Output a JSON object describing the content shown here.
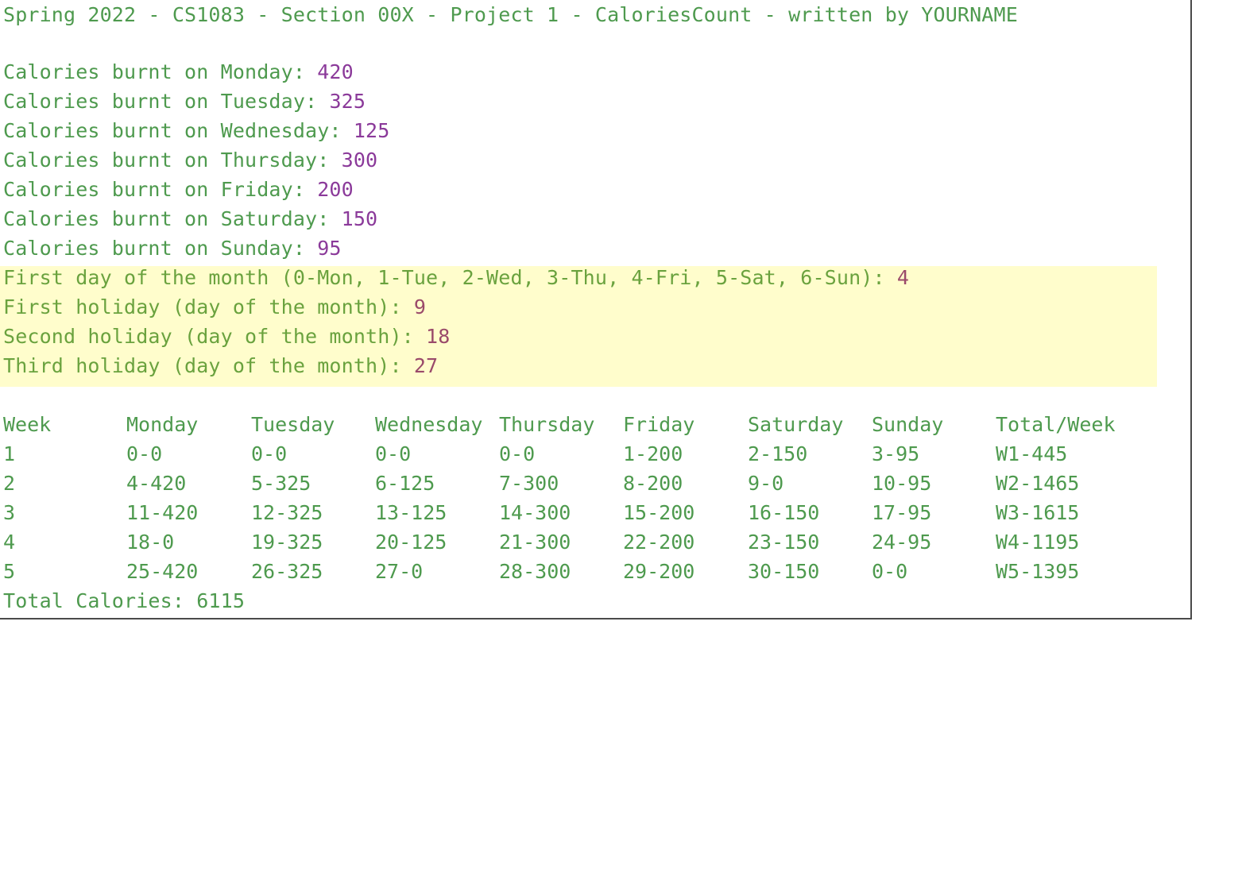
{
  "header": {
    "title": "Spring 2022 - CS1083 - Section 00X - Project 1 - CaloriesCount - written by YOURNAME"
  },
  "calorie_inputs": [
    {
      "prompt": "Calories burnt on Monday: ",
      "value": "420"
    },
    {
      "prompt": "Calories burnt on Tuesday: ",
      "value": "325"
    },
    {
      "prompt": "Calories burnt on Wednesday: ",
      "value": "125"
    },
    {
      "prompt": "Calories burnt on Thursday: ",
      "value": "300"
    },
    {
      "prompt": "Calories burnt on Friday: ",
      "value": "200"
    },
    {
      "prompt": "Calories burnt on Saturday: ",
      "value": "150"
    },
    {
      "prompt": "Calories burnt on Sunday: ",
      "value": "95"
    }
  ],
  "month_inputs": [
    {
      "prompt": "First day of the month (0-Mon, 1-Tue, 2-Wed, 3-Thu, 4-Fri, 5-Sat, 6-Sun): ",
      "value": "4"
    },
    {
      "prompt": "First holiday (day of the month): ",
      "value": "9"
    },
    {
      "prompt": "Second holiday (day of the month): ",
      "value": "18"
    },
    {
      "prompt": "Third holiday (day of the month): ",
      "value": "27"
    }
  ],
  "table": {
    "headers": [
      "Week",
      "Monday",
      "Tuesday",
      "Wednesday",
      "Thursday",
      "Friday",
      "Saturday",
      "Sunday",
      "Total/Week"
    ],
    "rows": [
      [
        "1",
        "0-0",
        "0-0",
        "0-0",
        "0-0",
        "1-200",
        "2-150",
        "3-95",
        "W1-445"
      ],
      [
        "2",
        "4-420",
        "5-325",
        "6-125",
        "7-300",
        "8-200",
        "9-0",
        "10-95",
        "W2-1465"
      ],
      [
        "3",
        "11-420",
        "12-325",
        "13-125",
        "14-300",
        "15-200",
        "16-150",
        "17-95",
        "W3-1615"
      ],
      [
        "4",
        "18-0",
        "19-325",
        "20-125",
        "21-300",
        "22-200",
        "23-150",
        "24-95",
        "W4-1195"
      ],
      [
        "5",
        "25-420",
        "26-325",
        "27-0",
        "28-300",
        "29-200",
        "30-150",
        "0-0",
        "W5-1395"
      ]
    ]
  },
  "total": {
    "label": "Total Calories: ",
    "value": "6115"
  },
  "colors": {
    "text": "#4e9a4e",
    "input_value": "#8b3a9a",
    "highlight_bg": "#fffdcc",
    "highlight_value": "#9a4a6a"
  }
}
